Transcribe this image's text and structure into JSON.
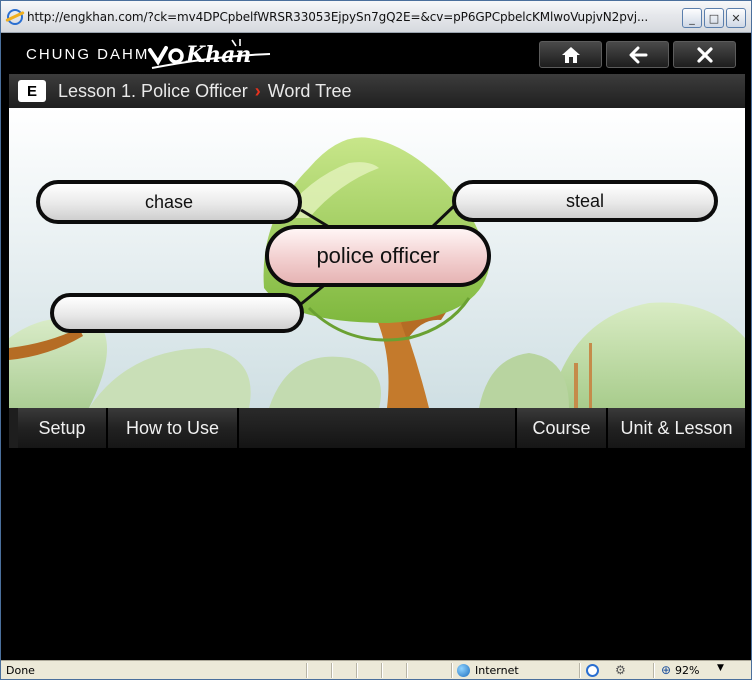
{
  "window": {
    "title": "http://engkhan.com/?ck=mv4DPCpbelfWRSR33053EjpySn7gQ2E=&cv=pP6GPCpbelcKMlwoVupjvN2pvj...",
    "minimize_glyph": "_",
    "maximize_glyph": "□",
    "close_glyph": "✕"
  },
  "app": {
    "brand": "CHUNG DAHM",
    "logo_text": "Khan"
  },
  "header_buttons": {
    "home_icon": "home-icon",
    "back_icon": "arrow-left-icon",
    "close_icon": "close-icon"
  },
  "breadcrumb": {
    "badge": "E",
    "lesson": "Lesson 1. Police Officer",
    "separator": "›",
    "page": "Word Tree"
  },
  "word_tree": {
    "center": "police officer",
    "branches": [
      "chase",
      "steal",
      ""
    ]
  },
  "bottom_nav": {
    "setup": "Setup",
    "how_to_use": "How to Use",
    "course": "Course",
    "unit_lesson": "Unit & Lesson"
  },
  "status_bar": {
    "status": "Done",
    "zone": "Internet",
    "zoom": "92%"
  },
  "colors": {
    "center_pill": "#f2cfcf",
    "breadcrumb_separator": "#e8321e",
    "sky": "#dfe9ec",
    "foliage": "#8cc34a"
  }
}
